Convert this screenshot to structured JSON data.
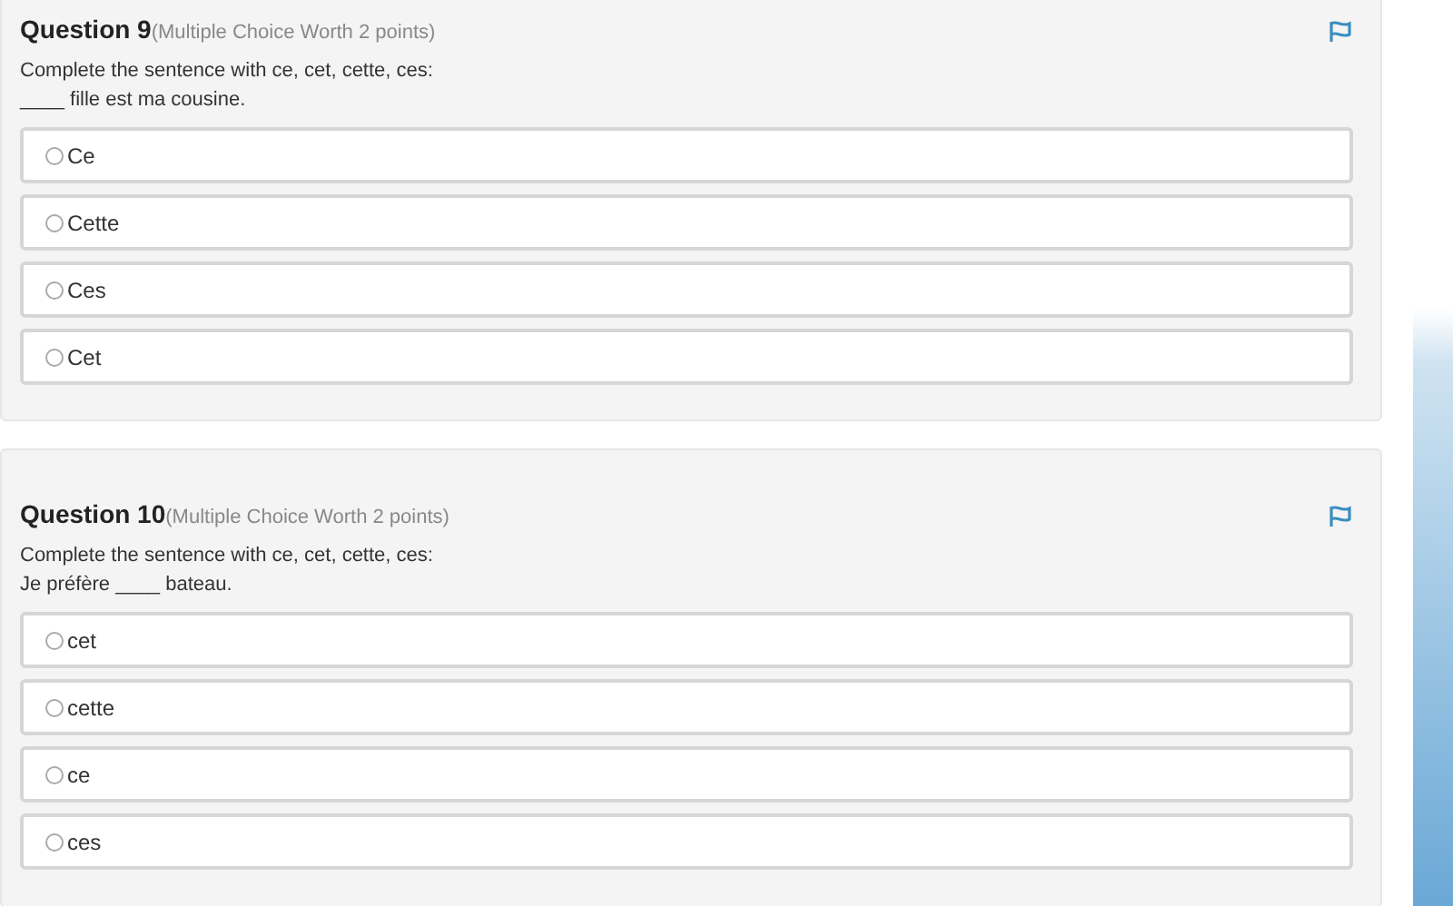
{
  "questions": [
    {
      "title": "Question 9",
      "meta": "(Multiple Choice Worth 2 points)",
      "prompt": "Complete the sentence with ce, cet, cette, ces:",
      "sentence": "____ fille est ma cousine.",
      "options": [
        {
          "label": "Ce",
          "selected": false
        },
        {
          "label": "Cette",
          "selected": false
        },
        {
          "label": "Ces",
          "selected": false
        },
        {
          "label": "Cet",
          "selected": false
        }
      ]
    },
    {
      "title": "Question 10",
      "meta": "(Multiple Choice Worth 2 points)",
      "prompt": "Complete the sentence with ce, cet, cette, ces:",
      "sentence": "Je préfère ____ bateau.",
      "options": [
        {
          "label": "cet",
          "selected": false
        },
        {
          "label": "cette",
          "selected": false
        },
        {
          "label": "ce",
          "selected": false
        },
        {
          "label": "ces",
          "selected": false
        }
      ]
    }
  ]
}
